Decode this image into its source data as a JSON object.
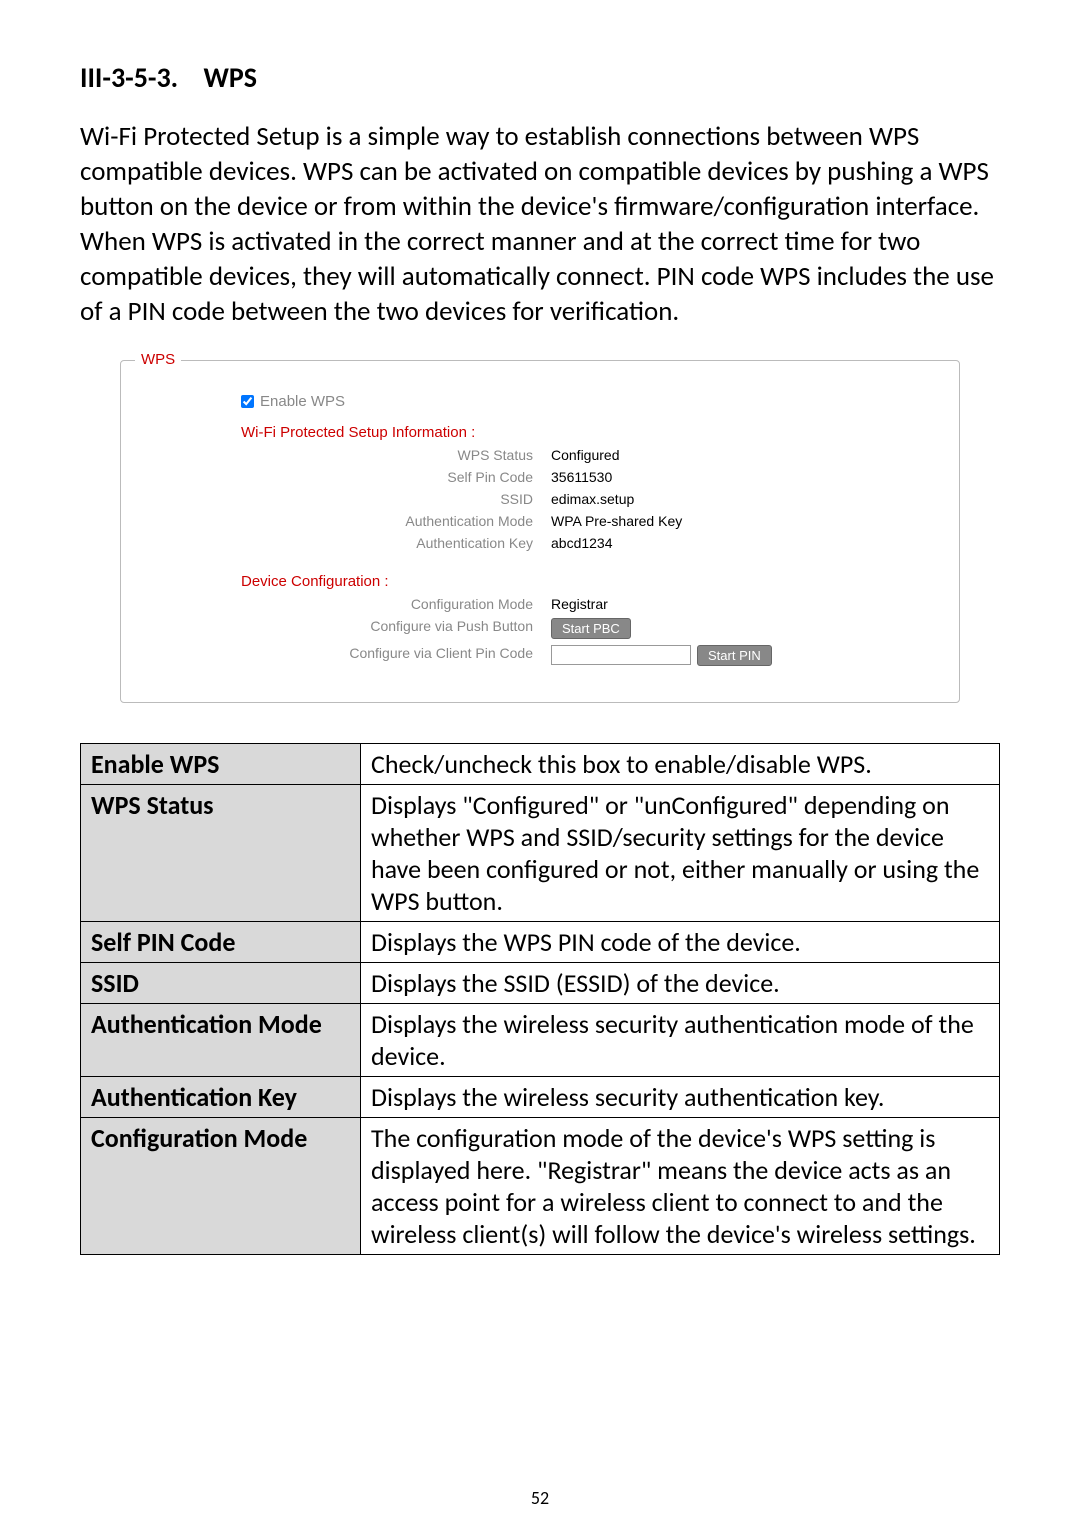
{
  "heading_number": "III-3-5-3.",
  "heading_title": "WPS",
  "body_paragraph": "Wi-Fi Protected Setup is a simple way to establish connections between WPS compatible devices. WPS can be activated on compatible devices by pushing a WPS button on the device or from within the device's firmware/configuration interface. When WPS is activated in the correct manner and at the correct time for two compatible devices, they will automatically connect. PIN code WPS includes the use of a PIN code between the two devices for verification.",
  "wps_panel": {
    "legend": "WPS",
    "enable_label": "Enable  WPS",
    "enable_checked": true,
    "info_heading": "Wi-Fi Protected Setup Information  :",
    "fields": {
      "wps_status_label": "WPS Status",
      "wps_status_value": "Configured",
      "self_pin_label": "Self Pin Code",
      "self_pin_value": "35611530",
      "ssid_label": "SSID",
      "ssid_value": "edimax.setup",
      "auth_mode_label": "Authentication Mode",
      "auth_mode_value": "WPA Pre-shared Key",
      "auth_key_label": "Authentication Key",
      "auth_key_value": "abcd1234"
    },
    "device_heading": "Device Configuration  :",
    "device": {
      "config_mode_label": "Configuration Mode",
      "config_mode_value": "Registrar",
      "push_button_label": "Configure via Push Button",
      "push_button_btn": "Start PBC",
      "pin_label": "Configure via Client Pin Code",
      "pin_value": "",
      "pin_btn": "Start PIN"
    }
  },
  "def_table": [
    {
      "term": "Enable WPS",
      "desc": "Check/uncheck this box to enable/disable WPS."
    },
    {
      "term": "WPS Status",
      "desc": "Displays \"Configured\" or \"unConfigured\" depending on whether WPS and SSID/security settings for the device have been configured or not, either manually or using the WPS button."
    },
    {
      "term": "Self PIN Code",
      "desc": "Displays the WPS PIN code of the device."
    },
    {
      "term": "SSID",
      "desc": "Displays the SSID (ESSID) of the device."
    },
    {
      "term": "Authentication Mode",
      "desc": "Displays the wireless security authentication mode of the device."
    },
    {
      "term": "Authentication Key",
      "desc": "Displays the wireless security authentication key."
    },
    {
      "term": "Configuration Mode",
      "desc": "The configuration mode of the device's WPS setting is displayed here. \"Registrar\" means the device acts as an access point for a wireless client to connect to and the wireless client(s) will follow the device's wireless settings."
    }
  ],
  "page_number": "52"
}
